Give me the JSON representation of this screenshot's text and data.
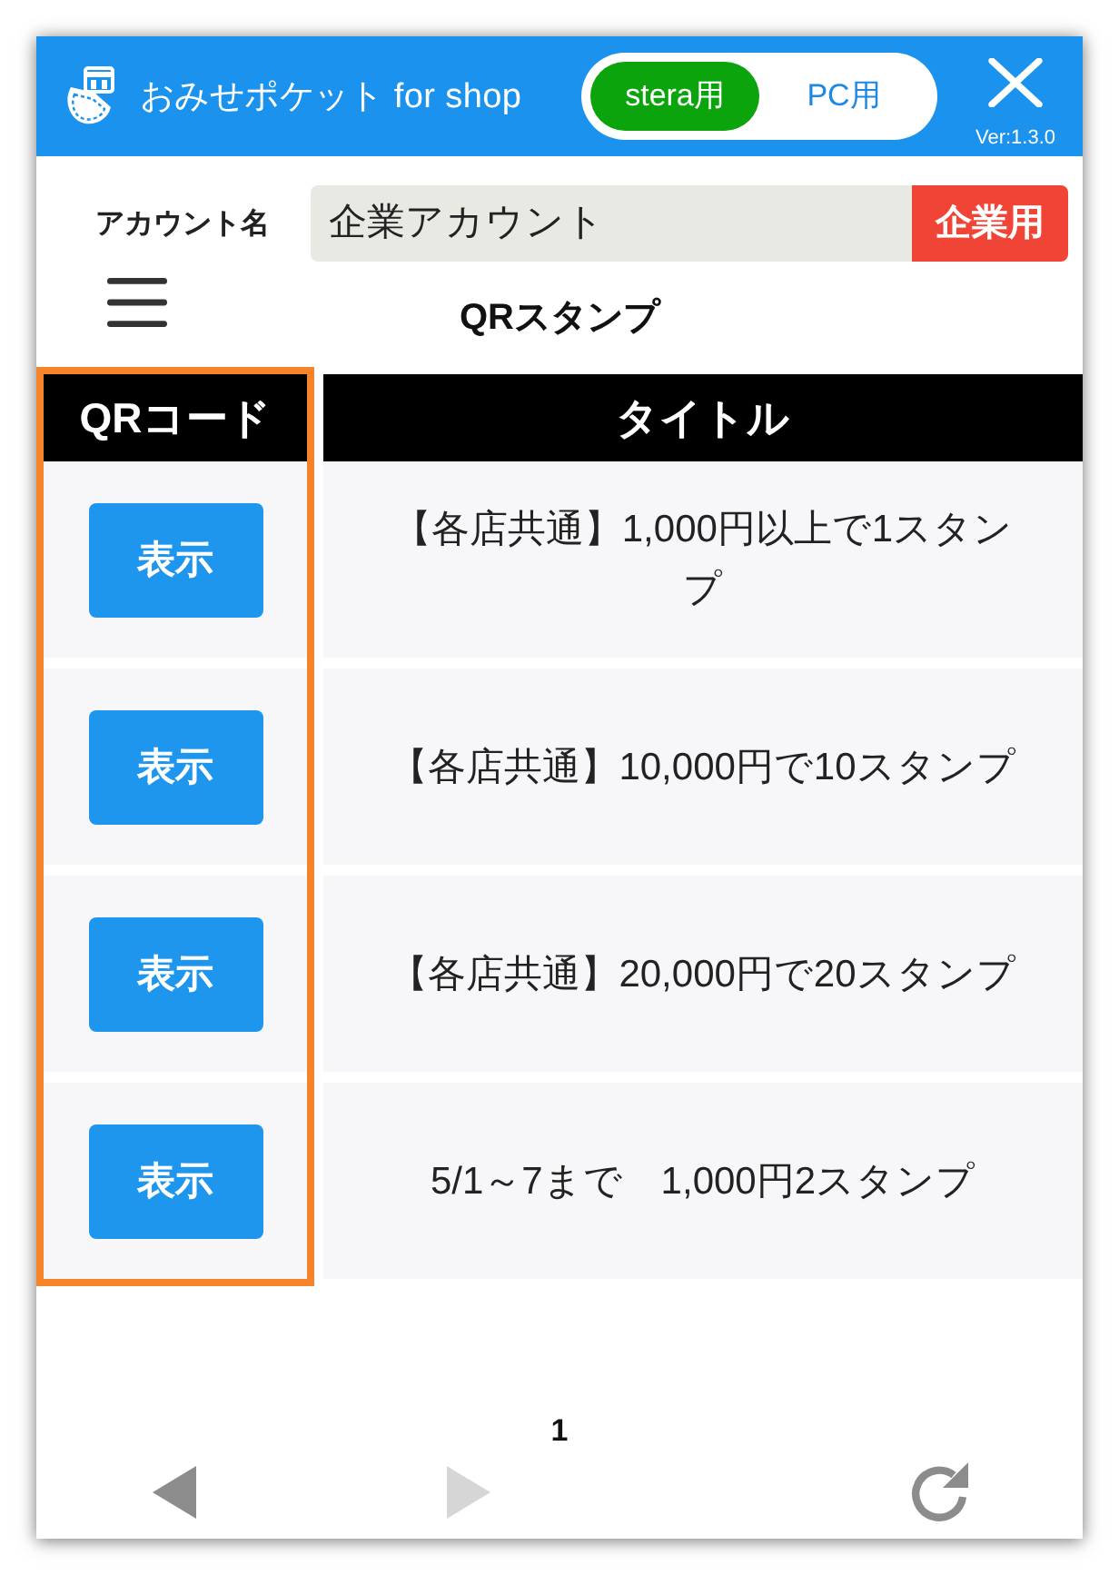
{
  "header": {
    "app_title": "おみせポケット for shop",
    "mode_toggle": [
      {
        "label": "stera用",
        "selected": true
      },
      {
        "label": "PC用",
        "selected": false
      }
    ],
    "version": "Ver:1.3.0"
  },
  "account": {
    "label": "アカウント名",
    "value": "企業アカウント",
    "type_badge": "企業用"
  },
  "page_title": "QRスタンプ",
  "table": {
    "columns": [
      {
        "label": "QRコード",
        "highlighted": true
      },
      {
        "label": "タイトル",
        "highlighted": false
      }
    ],
    "rows": [
      {
        "button": "表示",
        "title": "【各店共通】1,000円以上で1スタンプ"
      },
      {
        "button": "表示",
        "title": "【各店共通】10,000円で10スタンプ"
      },
      {
        "button": "表示",
        "title": "【各店共通】20,000円で20スタンプ"
      },
      {
        "button": "表示",
        "title": "5/1～7まで　1,000円2スタンプ"
      }
    ]
  },
  "pagination": {
    "page": "1",
    "previous": {
      "disabled": false
    },
    "next": {
      "disabled": true
    }
  }
}
